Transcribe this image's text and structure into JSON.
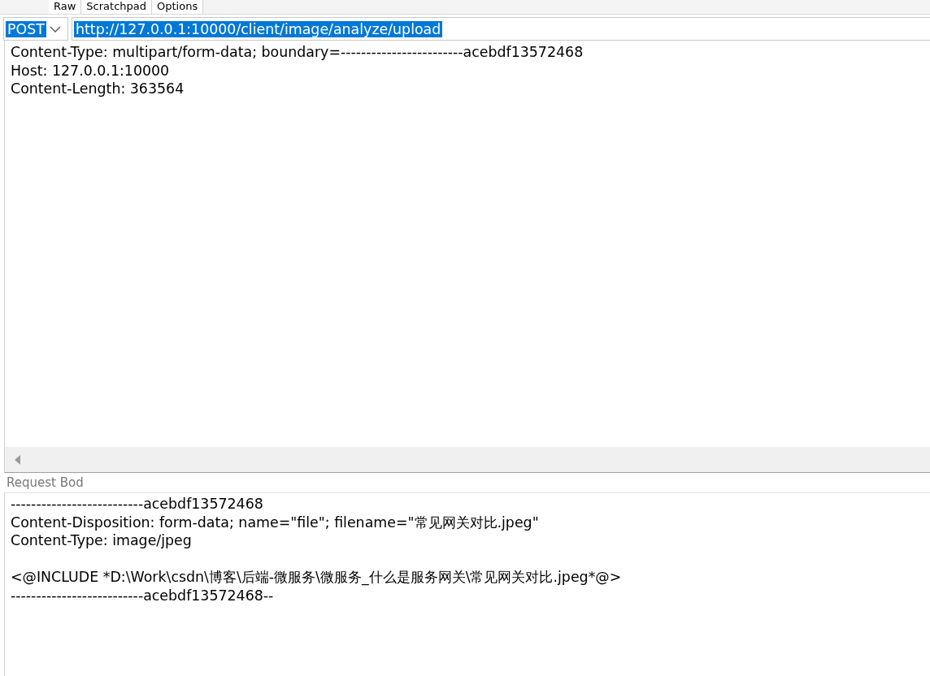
{
  "tabs": [
    {
      "label": "Raw",
      "selected": false
    },
    {
      "label": "Scratchpad",
      "selected": false
    },
    {
      "label": "Options",
      "selected": false
    }
  ],
  "request": {
    "method": "POST",
    "method_selected": true,
    "url": "http://127.0.0.1:10000/client/image/analyze/upload",
    "url_selected": true
  },
  "headers": [
    "Content-Type: multipart/form-data; boundary=------------------------acebdf13572468",
    "Host: 127.0.0.1:10000",
    "Content-Length: 363564"
  ],
  "body_label": "Request Bod",
  "body": [
    {
      "text": "--------------------------acebdf13572468",
      "gap_before": false
    },
    {
      "text": "Content-Disposition: form-data; name=\"file\"; filename=\"常见网关对比.jpeg\"",
      "gap_before": false
    },
    {
      "text": "Content-Type: image/jpeg",
      "gap_before": false
    },
    {
      "text": "<@INCLUDE *D:\\Work\\csdn\\博客\\后端-微服务\\微服务_什么是服务网关\\常见网关对比.jpeg*@>",
      "gap_before": true
    },
    {
      "text": "--------------------------acebdf13572468--",
      "gap_before": false
    }
  ]
}
